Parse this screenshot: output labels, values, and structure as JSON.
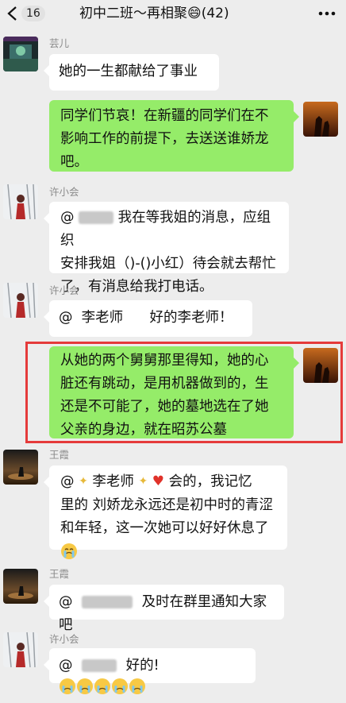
{
  "header": {
    "unread_count": "16",
    "group_title": "初中二班～再相聚😄(42)"
  },
  "messages": [
    {
      "sender": "芸儿",
      "text": "她的一生都献给了事业"
    },
    {
      "sender": "me",
      "line1": "同学们节哀！在新疆的同学们在不",
      "line2": "影响工作的前提下，去送送谁娇龙",
      "line3": "吧。"
    },
    {
      "sender": "许小会",
      "line1_a": "@",
      "line1_b": "我在等我姐的消息，应组织",
      "line2": "安排我姐（)-()小红）待会就去帮忙",
      "line3": "了，有消息给我打电话。"
    },
    {
      "sender": "许小会",
      "text": "@  李老师      好的李老师！"
    },
    {
      "sender": "me",
      "line1": "从她的两个舅舅那里得知，她的心",
      "line2": "脏还有跳动，是用机器做到的，生",
      "line3": "还是不可能了，她的墓地选在了她",
      "line4": "父亲的身边，就在昭苏公墓"
    },
    {
      "sender": "王霞",
      "line1_a": "@",
      "line1_b": "李老师",
      "line1_c": "会的，我记忆",
      "line2": "里的 刘娇龙永远还是初中时的青涩",
      "line3": "和年轻，这一次她可以好好休息了"
    },
    {
      "sender": "王霞",
      "text_a": "@",
      "text_b": "及时在群里通知大家吧"
    },
    {
      "sender": "许小会",
      "text_a": "@",
      "text_b": "好的!"
    }
  ]
}
